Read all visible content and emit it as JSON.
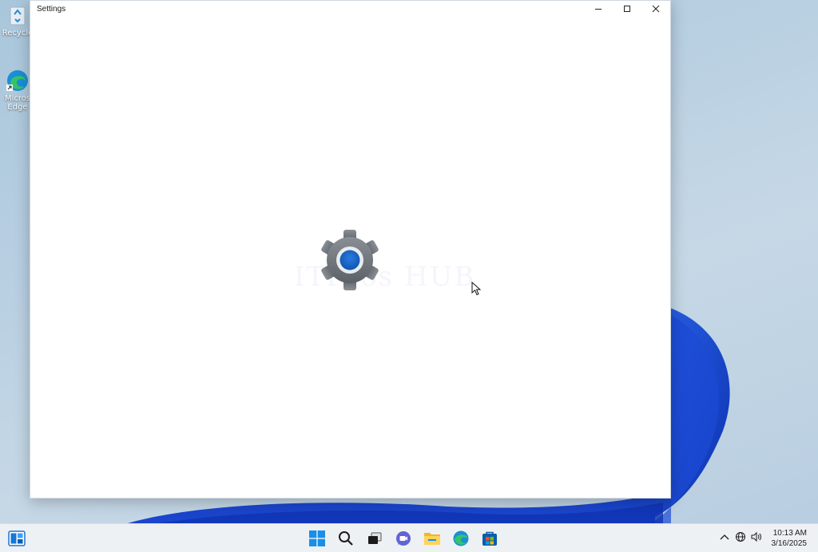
{
  "desktop": {
    "icons": [
      {
        "name": "recycle-bin",
        "label": "Recycle"
      },
      {
        "name": "edge",
        "label": "Micros Edge"
      }
    ]
  },
  "window": {
    "title": "Settings",
    "controls": [
      "minimize-icon",
      "maximize-icon",
      "close-icon"
    ],
    "splash_icon": "settings-gear-icon",
    "watermark": "ITPros HUB"
  },
  "taskbar": {
    "apps": [
      "start-icon",
      "search-icon",
      "task-view-icon",
      "teams-chat-icon",
      "file-explorer-icon",
      "edge-icon",
      "store-icon"
    ],
    "tray": [
      "chevron-up-icon",
      "network-icon",
      "volume-icon"
    ],
    "time": "10:13 AM",
    "date": "3/16/2025"
  },
  "colors": {
    "accent": "#0f5fb8",
    "wallpaper_blue": "#1a46c8",
    "taskbar_bg": "#eef1f4"
  }
}
